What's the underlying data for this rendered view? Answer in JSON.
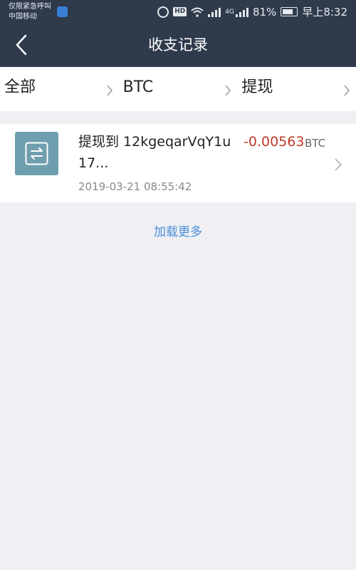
{
  "status_bar": {
    "carrier_line1": "仅限紧急呼叫",
    "carrier_line2": "中国移动",
    "hd_badge": "HD",
    "network_type": "4G",
    "battery": "81%",
    "time": "早上8:32"
  },
  "nav": {
    "title": "收支记录",
    "back_icon": "chevron-left-icon"
  },
  "filters": [
    {
      "label": "全部"
    },
    {
      "label": "BTC"
    },
    {
      "label": "提现"
    }
  ],
  "records": [
    {
      "icon": "transfer-icon",
      "title": "提现到 12kgeqarVqY1u17...",
      "amount": "-0.00563",
      "unit": "BTC",
      "time": "2019-03-21 08:55:42"
    }
  ],
  "load_more": "加载更多",
  "colors": {
    "header_bg": "#2f3a4b",
    "page_bg": "#efeff4",
    "amount_negative": "#c0392b",
    "link": "#4a90d9",
    "icon_bg": "#6f9fae"
  }
}
